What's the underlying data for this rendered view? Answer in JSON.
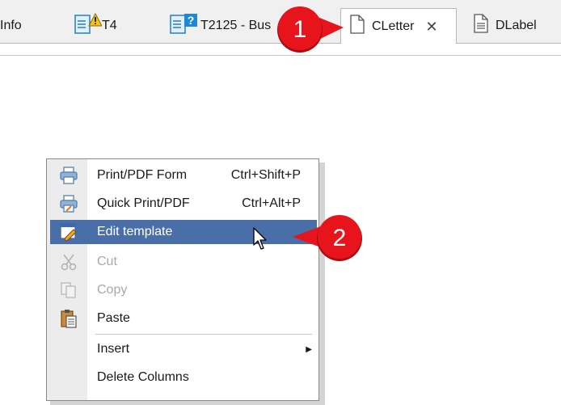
{
  "tabs": [
    {
      "label": "Info",
      "icon": "none"
    },
    {
      "label": "T4",
      "icon": "document-warning-icon"
    },
    {
      "label": "T2125 - Bus",
      "icon": "document-question-icon"
    },
    {
      "label": "CLetter",
      "icon": "document-icon",
      "active": true,
      "close": "✕"
    },
    {
      "label": "DLabel",
      "icon": "document-lines-icon"
    }
  ],
  "menu": {
    "items": [
      {
        "label": "Print/PDF Form",
        "shortcut": "Ctrl+Shift+P",
        "icon": "printer-icon"
      },
      {
        "label": "Quick Print/PDF",
        "shortcut": "Ctrl+Alt+P",
        "icon": "quick-print-icon"
      },
      {
        "label": "Edit template",
        "shortcut": "",
        "icon": "edit-template-icon"
      },
      {
        "label": "Cut",
        "shortcut": "",
        "icon": "scissors-icon"
      },
      {
        "label": "Copy",
        "shortcut": "",
        "icon": "copy-icon"
      },
      {
        "label": "Paste",
        "shortcut": "",
        "icon": "paste-icon"
      },
      {
        "label": "Insert",
        "shortcut": "",
        "icon": "none",
        "submenu": true
      },
      {
        "label": "Delete Columns",
        "shortcut": "",
        "icon": "none"
      }
    ],
    "highlight_color": "#4a6fa8"
  },
  "callouts": [
    {
      "number": "1",
      "color": "#e8141b"
    },
    {
      "number": "2",
      "color": "#e8141b"
    }
  ]
}
